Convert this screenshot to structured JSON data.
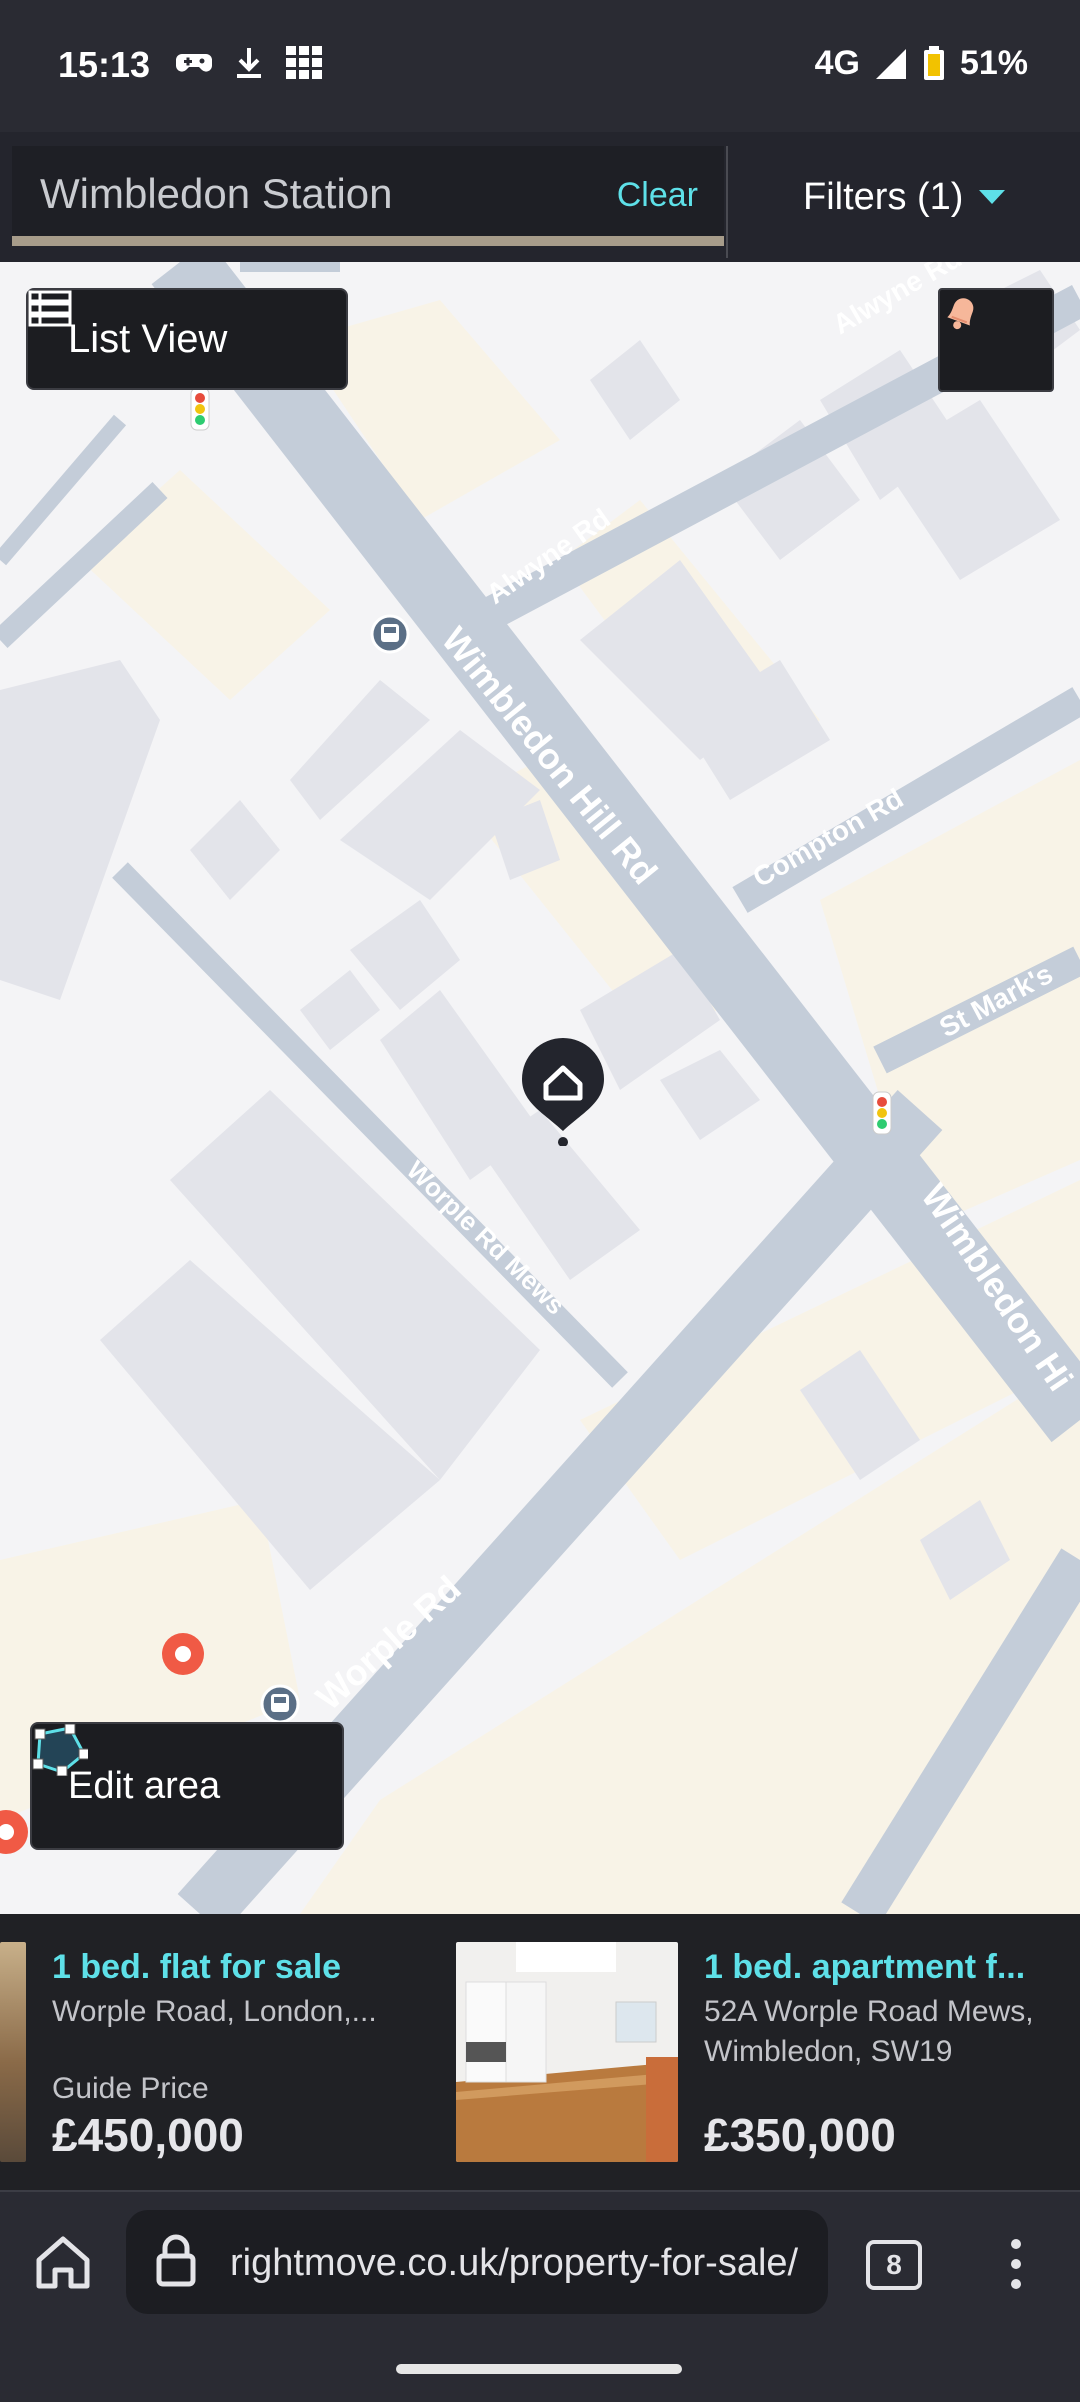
{
  "status_bar": {
    "time": "15:13",
    "network": "4G",
    "battery": "51%"
  },
  "search": {
    "location": "Wimbledon Station",
    "clear_label": "Clear",
    "filters_label": "Filters (1)"
  },
  "map": {
    "list_view_label": "List View",
    "edit_area_label": "Edit area",
    "street_labels": [
      "Alwyne Rd",
      "Alwyne Rd",
      "Wimbledon Hill Rd",
      "Compton Rd",
      "St Mark's",
      "Worple Rd Mews",
      "Wimbledon Hi",
      "Worple Rd"
    ]
  },
  "listings": [
    {
      "title": "1 bed. flat for sale",
      "address": "Worple Road, London,...",
      "price_label": "Guide Price",
      "price": "£450,000"
    },
    {
      "title": "1 bed. apartment f...",
      "address_line1": "52A Worple Road Mews,",
      "address_line2": "Wimbledon, SW19",
      "price": "£350,000"
    }
  ],
  "browser": {
    "url": "rightmove.co.uk/property-for-sale/",
    "tab_count": "8"
  },
  "colors": {
    "accent": "#5ee0e8",
    "marker": "#f05a45",
    "map_road": "#c4cdd9",
    "map_building": "#e3e4ea",
    "map_land": "#f8f3e7"
  }
}
